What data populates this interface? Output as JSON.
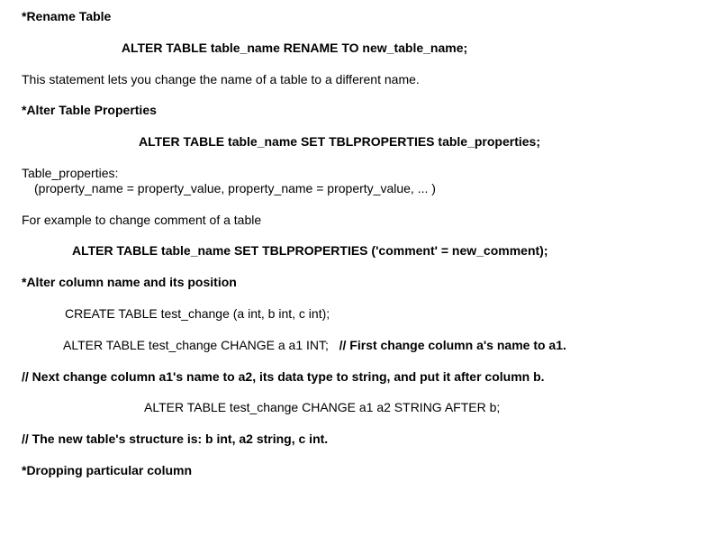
{
  "lines": {
    "h_rename": "*Rename Table",
    "code_rename": "ALTER TABLE table_name RENAME TO new_table_name;",
    "txt_rename_desc": "This statement lets you change the name of a table to a different name.",
    "h_alter_props": "*Alter Table Properties",
    "code_alter_props": "ALTER TABLE table_name SET TBLPROPERTIES table_properties;",
    "txt_tp1": "Table_properties:",
    "txt_tp2": "(property_name = property_value, property_name = property_value, ... )",
    "txt_eg": "For example to change comment of a table",
    "code_comment": "ALTER TABLE table_name SET TBLPROPERTIES ('comment' = new_comment);",
    "h_alter_col": "*Alter column name and its position",
    "code_create": "CREATE TABLE test_change (a int, b int, c int);",
    "code_change_a": "ALTER TABLE test_change CHANGE a a1 INT;",
    "comment_first": "// First change column a's name to a1.",
    "comment_next": "// Next change column a1's name to a2, its data type to string, and put it after column b.",
    "code_change_a1": "ALTER TABLE test_change CHANGE a1 a2 STRING AFTER b;",
    "comment_struct": "// The new table's structure is:  b int, a2 string, c int.",
    "h_drop": "*Dropping particular column"
  }
}
